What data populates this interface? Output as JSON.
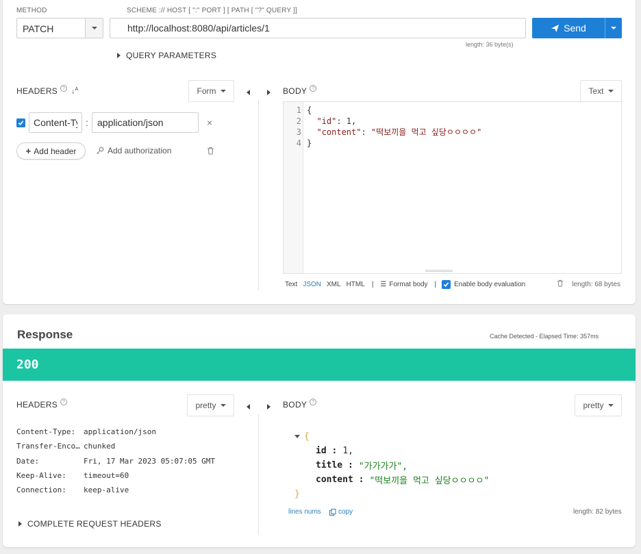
{
  "request": {
    "method_label": "METHOD",
    "method_value": "PATCH",
    "url_label": "SCHEME :// HOST [ \":\" PORT ] [ PATH [ \"?\" QUERY ]]",
    "url_value": "http://localhost:8080/api/articles/1",
    "url_length": "length: 36 byte(s)",
    "send_label": "Send",
    "query_params_label": "QUERY PARAMETERS",
    "headers_title": "HEADERS",
    "headers_mode": "Form",
    "header_rows": [
      {
        "name": "Content-Type",
        "value": "application/json",
        "enabled": true
      }
    ],
    "add_header_label": "Add header",
    "add_auth_label": "Add authorization",
    "body_title": "BODY",
    "body_mode": "Text",
    "body_lines": [
      {
        "num": "1",
        "text": "{"
      },
      {
        "num": "2",
        "key": "\"id\"",
        "rest": ": 1,"
      },
      {
        "num": "3",
        "key": "\"content\"",
        "str": "\"떡보끼을 먹고 싶당ㅇㅇㅇㅇ\""
      },
      {
        "num": "4",
        "text": "}"
      }
    ],
    "body_formats": [
      "Text",
      "JSON",
      "XML",
      "HTML"
    ],
    "body_format_active": "JSON",
    "format_body_label": "Format body",
    "enable_eval_label": "Enable body evaluation",
    "enable_eval_checked": true,
    "body_length": "length: 68 bytes"
  },
  "response": {
    "title": "Response",
    "cache_info": "Cache Detected - Elapsed Time: 357ms",
    "status_code": "200",
    "headers_title": "HEADERS",
    "headers_mode": "pretty",
    "headers": [
      {
        "name": "Content-Type:",
        "value": "application/json"
      },
      {
        "name": "Transfer-Enco…",
        "value": "chunked"
      },
      {
        "name": "Date:",
        "value": "Fri, 17 Mar 2023 05:07:05 GMT"
      },
      {
        "name": "Keep-Alive:",
        "value": "timeout=60"
      },
      {
        "name": "Connection:",
        "value": "keep-alive"
      }
    ],
    "complete_headers_label": "COMPLETE REQUEST HEADERS",
    "body_title": "BODY",
    "body_mode": "pretty",
    "body_open": "{",
    "body_close": "}",
    "body_fields": [
      {
        "key": "id :",
        "value": "1,"
      },
      {
        "key": "title :",
        "value": "\"가가가가\","
      },
      {
        "key": "content :",
        "value": "\"떡보끼을 먹고 싶당ㅇㅇㅇㅇ\""
      }
    ],
    "lines_nums_label": "lines nums",
    "copy_label": "copy",
    "body_length": "length: 82 bytes"
  },
  "colors": {
    "accent": "#1e7fd7",
    "status_ok": "#1bc5a2",
    "link": "#2c7fb8",
    "json_string": "#8a1a1a",
    "resp_string": "#1a7f1a"
  }
}
